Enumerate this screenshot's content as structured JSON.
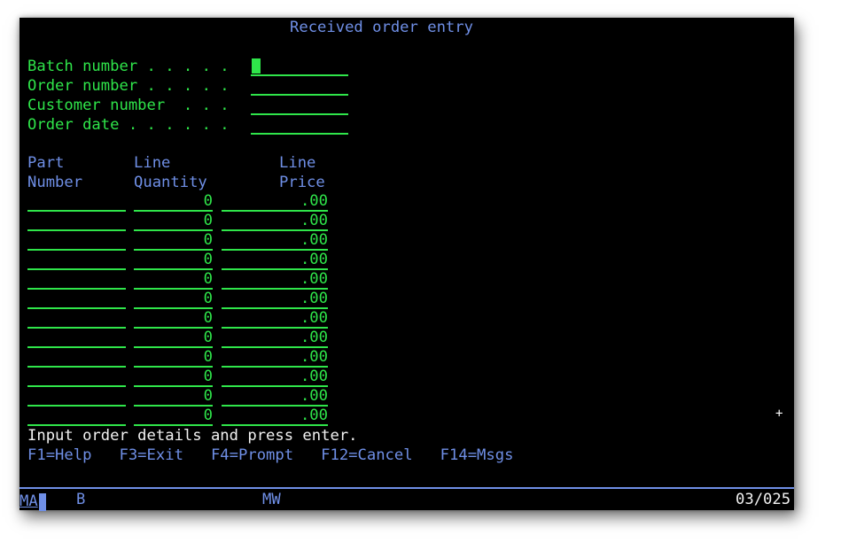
{
  "screen": {
    "title": "Received order entry",
    "header_fields": [
      {
        "label": "Batch number . . . . .",
        "value": ""
      },
      {
        "label": "Order number . . . . .",
        "value": ""
      },
      {
        "label": "Customer number  . . .",
        "value": ""
      },
      {
        "label": "Order date . . . . . .",
        "value": ""
      }
    ],
    "columns": {
      "part": [
        "Part",
        "Number"
      ],
      "qty": [
        "Line",
        "Quantity"
      ],
      "price": [
        "Line",
        "Price"
      ]
    },
    "rows": [
      {
        "part": "",
        "qty": "0",
        "price": ".00"
      },
      {
        "part": "",
        "qty": "0",
        "price": ".00"
      },
      {
        "part": "",
        "qty": "0",
        "price": ".00"
      },
      {
        "part": "",
        "qty": "0",
        "price": ".00"
      },
      {
        "part": "",
        "qty": "0",
        "price": ".00"
      },
      {
        "part": "",
        "qty": "0",
        "price": ".00"
      },
      {
        "part": "",
        "qty": "0",
        "price": ".00"
      },
      {
        "part": "",
        "qty": "0",
        "price": ".00"
      },
      {
        "part": "",
        "qty": "0",
        "price": ".00"
      },
      {
        "part": "",
        "qty": "0",
        "price": ".00"
      },
      {
        "part": "",
        "qty": "0",
        "price": ".00"
      },
      {
        "part": "",
        "qty": "0",
        "price": ".00"
      }
    ],
    "more_indicator": "+",
    "message": "Input order details and press enter.",
    "function_keys": "F1=Help   F3=Exit   F4=Prompt   F12=Cancel   F14=Msgs"
  },
  "status_bar": {
    "mode": "MA",
    "b_indicator": "B",
    "mw_indicator": "MW",
    "cursor_position": "03/025"
  },
  "colors": {
    "background": "#000000",
    "label_blue": "#6f8fe6",
    "field_green": "#2fe54a",
    "text_white": "#f2f2f2"
  }
}
